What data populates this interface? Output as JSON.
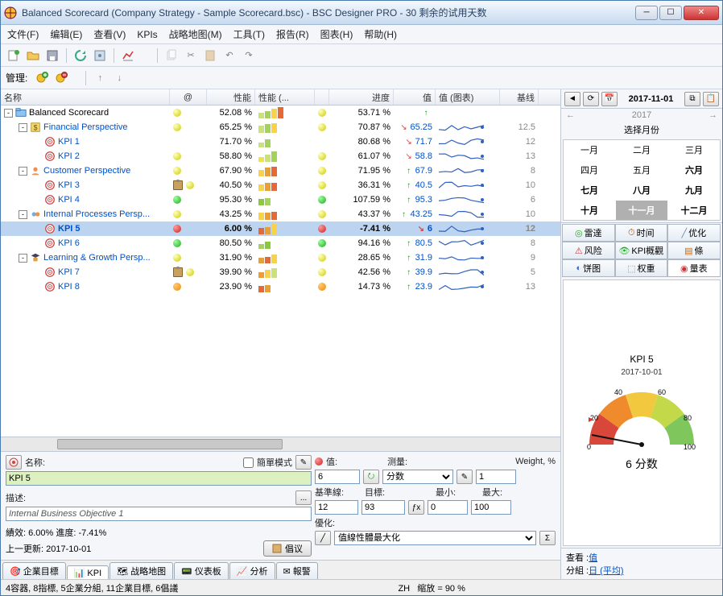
{
  "window_title": "Balanced Scorecard (Company Strategy - Sample Scorecard.bsc) - BSC Designer PRO - 30 剩余的试用天数",
  "menu": [
    "文件(F)",
    "编辑(E)",
    "查看(V)",
    "KPIs",
    "战略地图(M)",
    "工具(T)",
    "报告(R)",
    "图表(H)",
    "帮助(H)"
  ],
  "mgmt_label": "管理:",
  "columns": {
    "name": "名称",
    "at": "@",
    "perf": "性能",
    "perfchart": "性能 (...",
    "prog": "进度",
    "val": "值",
    "valchart": "值 (图表)",
    "base": "基线"
  },
  "rows": [
    {
      "indent": 0,
      "toggle": "-",
      "icon": "folder",
      "label": "Balanced Scorecard",
      "link": false,
      "at": "yellow",
      "perf": "52.08 %",
      "pc": [
        "#c9e27c",
        "#a5d25e",
        "#f7d24a",
        "#e36a36"
      ],
      "pdot": "yellow",
      "prog": "53.71 %",
      "arrow": "up",
      "val": "",
      "spark": "",
      "base": ""
    },
    {
      "indent": 1,
      "toggle": "-",
      "icon": "finance",
      "label": "Financial Perspective",
      "link": true,
      "at": "yellow",
      "perf": "65.25 %",
      "pc": [
        "#c9e27c",
        "#a5d25e",
        "#f7d24a"
      ],
      "pdot": "yellow",
      "prog": "70.87 %",
      "arrow": "dn",
      "val": "65.25",
      "spark": "blue",
      "base": "12.5"
    },
    {
      "indent": 2,
      "toggle": "",
      "icon": "kpi",
      "label": "KPI 1",
      "link": true,
      "at": "",
      "perf": "71.70 %",
      "pc": [
        "#c9e27c",
        "#a5d25e"
      ],
      "pdot": "",
      "prog": "80.68 %",
      "arrow": "dn",
      "val": "71.7",
      "spark": "blue",
      "base": "12"
    },
    {
      "indent": 2,
      "toggle": "",
      "icon": "kpi",
      "label": "KPI 2",
      "link": true,
      "at": "yellow",
      "perf": "58.80 %",
      "pc": [
        "#f0e24a",
        "#c9e27c",
        "#a5d25e"
      ],
      "pdot": "yellow",
      "prog": "61.07 %",
      "arrow": "dn",
      "val": "58.8",
      "spark": "blue",
      "base": "13"
    },
    {
      "indent": 1,
      "toggle": "-",
      "icon": "customer",
      "label": "Customer Perspective",
      "link": true,
      "at": "yellow",
      "perf": "67.90 %",
      "pc": [
        "#f7d24a",
        "#e8a036",
        "#e36a36"
      ],
      "pdot": "yellow",
      "prog": "71.95 %",
      "arrow": "up",
      "val": "67.9",
      "spark": "blue",
      "base": "8"
    },
    {
      "indent": 2,
      "toggle": "",
      "icon": "kpi",
      "label": "KPI 3",
      "link": true,
      "clip": true,
      "at": "yellow",
      "perf": "40.50 %",
      "pc": [
        "#f7d24a",
        "#e8a036",
        "#e36a36"
      ],
      "pdot": "yellow",
      "prog": "36.31 %",
      "arrow": "up",
      "val": "40.5",
      "spark": "blue",
      "base": "10"
    },
    {
      "indent": 2,
      "toggle": "",
      "icon": "kpi",
      "label": "KPI 4",
      "link": true,
      "at": "green",
      "perf": "95.30 %",
      "pc": [
        "#8cc83e",
        "#a5d25e"
      ],
      "pdot": "green",
      "prog": "107.59 %",
      "arrow": "up",
      "val": "95.3",
      "spark": "blue",
      "base": "6"
    },
    {
      "indent": 1,
      "toggle": "-",
      "icon": "internal",
      "label": "Internal Processes Persp...",
      "link": true,
      "at": "yellow",
      "perf": "43.25 %",
      "pc": [
        "#f7d24a",
        "#e8a036",
        "#e36a36"
      ],
      "pdot": "yellow",
      "prog": "43.37 %",
      "arrow": "up",
      "val": "43.25",
      "spark": "blue",
      "base": "10"
    },
    {
      "indent": 2,
      "toggle": "",
      "icon": "kpi",
      "label": "KPI 5",
      "link": true,
      "selected": true,
      "at": "red",
      "perf": "6.00 %",
      "pc": [
        "#e36a36",
        "#e8a036",
        "#f7d24a"
      ],
      "pdot": "red",
      "prog": "-7.41 %",
      "arrow": "dn",
      "val": "6",
      "spark": "blue",
      "base": "12"
    },
    {
      "indent": 2,
      "toggle": "",
      "icon": "kpi",
      "label": "KPI 6",
      "link": true,
      "at": "green",
      "perf": "80.50 %",
      "pc": [
        "#a5d25e",
        "#8cc83e"
      ],
      "pdot": "green",
      "prog": "94.16 %",
      "arrow": "up",
      "val": "80.5",
      "spark": "blue",
      "base": "8"
    },
    {
      "indent": 1,
      "toggle": "-",
      "icon": "learning",
      "label": "Learning & Growth Persp...",
      "link": true,
      "at": "yellow",
      "perf": "31.90 %",
      "pc": [
        "#e8a036",
        "#e36a36",
        "#f7d24a"
      ],
      "pdot": "yellow",
      "prog": "28.65 %",
      "arrow": "up",
      "val": "31.9",
      "spark": "blue",
      "base": "9"
    },
    {
      "indent": 2,
      "toggle": "",
      "icon": "kpi",
      "label": "KPI 7",
      "link": true,
      "clip": true,
      "at": "yellow",
      "perf": "39.90 %",
      "pc": [
        "#e8a036",
        "#f7d24a",
        "#c9e27c"
      ],
      "pdot": "yellow",
      "prog": "42.56 %",
      "arrow": "up",
      "val": "39.9",
      "spark": "blue",
      "base": "5"
    },
    {
      "indent": 2,
      "toggle": "",
      "icon": "kpi",
      "label": "KPI 8",
      "link": true,
      "at": "orange",
      "perf": "23.90 %",
      "pc": [
        "#e36a36",
        "#e8a036"
      ],
      "pdot": "orange",
      "prog": "14.73 %",
      "arrow": "up",
      "val": "23.9",
      "spark": "blue",
      "base": "13"
    }
  ],
  "detail": {
    "name_label": "名称:",
    "simple": "簡單模式",
    "name_value": "KPI 5",
    "desc_label": "描述:",
    "desc_value": "Internal Business Objective 1",
    "perf_line": "績效: 6.00%   進度: -7.41%",
    "update_line": "上一更新: 2017-10-01",
    "init_btn": "倡议",
    "value_label": "值:",
    "value": "6",
    "measure_label": "测量:",
    "measure": "分数",
    "weight_label": "Weight, %",
    "weight": "1",
    "baseline_label": "基準線:",
    "target_label": "目標:",
    "min_label": "最小:",
    "max_label": "最大:",
    "baseline": "12",
    "target": "93",
    "min": "0",
    "max": "100",
    "opt_label": "優化:",
    "opt": "值線性體最大化"
  },
  "tabs": [
    "企業目標",
    "KPI",
    "战略地图",
    "仪表板",
    "分析",
    "報警"
  ],
  "active_tab": 1,
  "status_left": "4容器, 8指標, 5企業分組, 11企業目標, 6倡議",
  "status_mid": "ZH",
  "status_zoom": "缩放 = 90 %",
  "right": {
    "date": "2017-11-01",
    "year": "2017",
    "pick_month": "选择月份",
    "months": [
      "一月",
      "二月",
      "三月",
      "四月",
      "五月",
      "六月",
      "七月",
      "八月",
      "九月",
      "十月",
      "十一月",
      "十二月"
    ],
    "bold_months": [
      5,
      6,
      7,
      8,
      9,
      10,
      11
    ],
    "selected_month": 10,
    "chart_tabs": [
      "雷達",
      "时间",
      "优化",
      "风险",
      "KPI概觀",
      "條",
      "饼图",
      "权重",
      "量表"
    ],
    "active_ctab": 8,
    "gauge": {
      "title": "KPI 5",
      "date": "2017-10-01",
      "value": "6 分数",
      "ticks": [
        "0",
        "20",
        "40",
        "60",
        "80",
        "100"
      ]
    },
    "view_label": "查看 :",
    "view_link": "值",
    "group_label": "分組 :",
    "group_link": "日 (平均)"
  }
}
